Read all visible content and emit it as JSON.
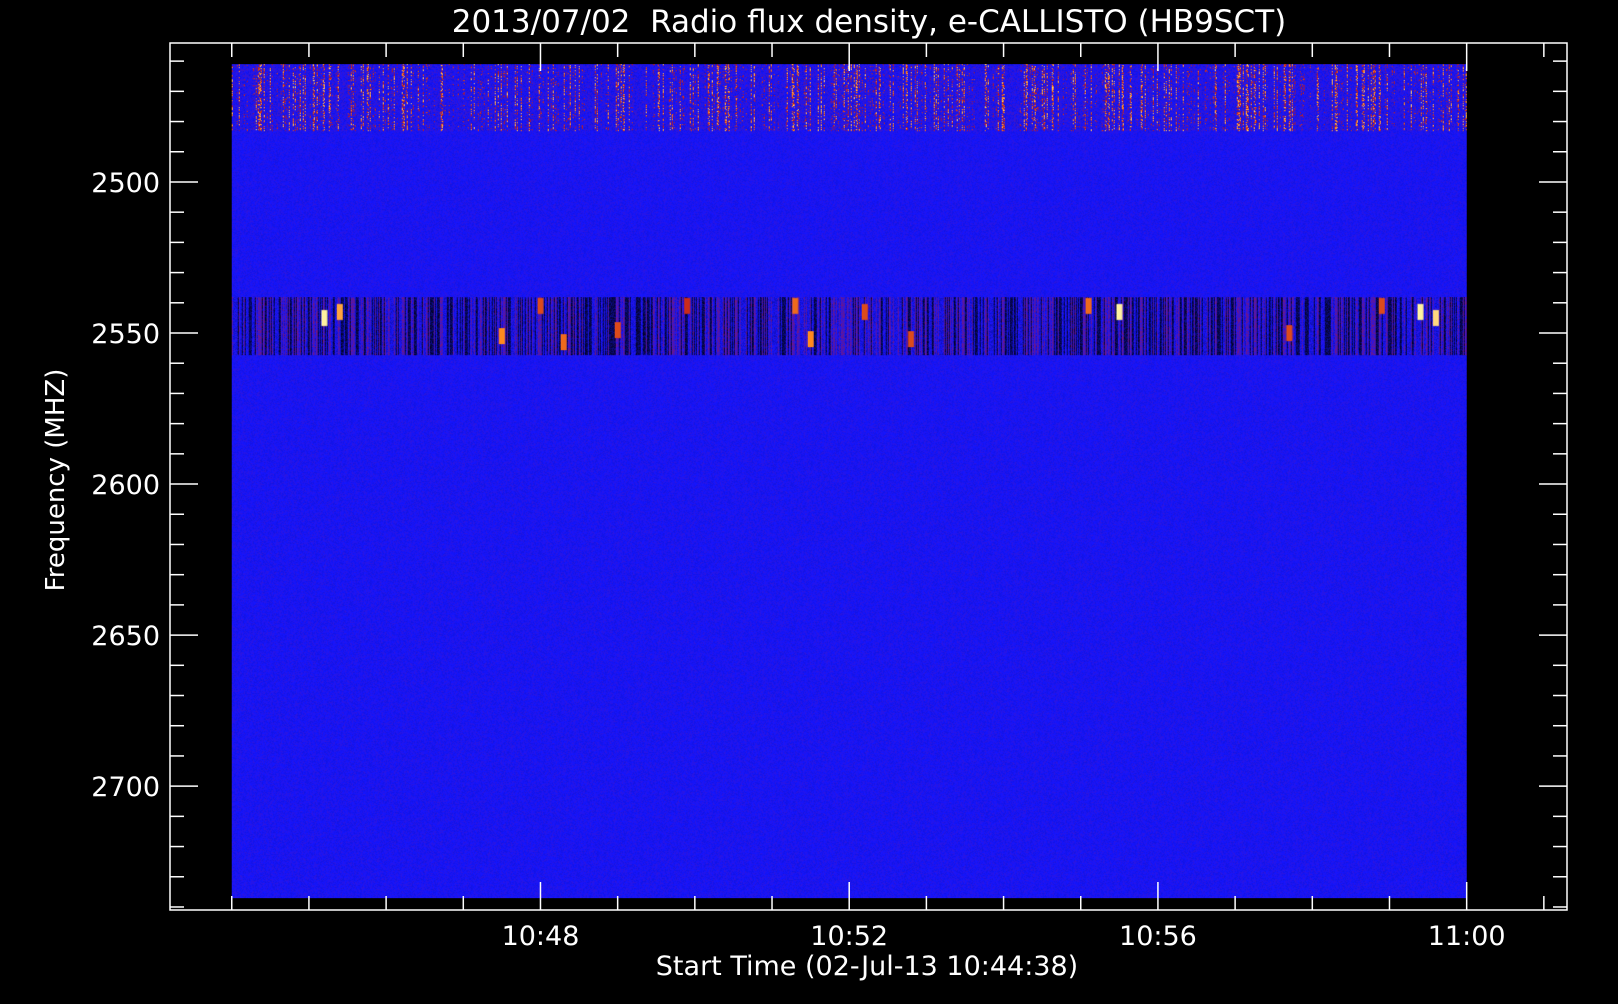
{
  "chart_data": {
    "type": "heatmap",
    "title": "2013/07/02  Radio flux density, e-CALLISTO (HB9SCT)",
    "xlabel": "Start Time (02-Jul-13 10:44:38)",
    "ylabel": "Frequency (MHZ)",
    "x_tick_labels": [
      "10:48",
      "10:52",
      "10:56",
      "11:00"
    ],
    "x_tick_minutes": [
      228,
      232,
      236,
      240
    ],
    "x_range_minutes": [
      223.2,
      241.3
    ],
    "data_range_minutes": [
      224.0,
      240.0
    ],
    "y_ticks": [
      2500,
      2550,
      2600,
      2650,
      2700
    ],
    "y_range": [
      2454,
      2741
    ],
    "data_freq_range": [
      2461,
      2737
    ],
    "y_inverted": true,
    "colormap": [
      "#000000",
      "#1515ff",
      "#c01818",
      "#ff8a1e",
      "#fff2a0"
    ],
    "background_level": 0.35,
    "bands": [
      {
        "from": 2461,
        "to": 2483,
        "description": "interference",
        "level": 0.75
      },
      {
        "from": 2538,
        "to": 2557,
        "description": "interference",
        "level": 0.6
      }
    ],
    "hot_spots": [
      {
        "minute": 225.2,
        "freq": 2545,
        "level": 1.0
      },
      {
        "minute": 225.4,
        "freq": 2543,
        "level": 0.85
      },
      {
        "minute": 227.5,
        "freq": 2551,
        "level": 0.8
      },
      {
        "minute": 228.0,
        "freq": 2541,
        "level": 0.7
      },
      {
        "minute": 228.3,
        "freq": 2553,
        "level": 0.75
      },
      {
        "minute": 229.0,
        "freq": 2549,
        "level": 0.7
      },
      {
        "minute": 229.9,
        "freq": 2541,
        "level": 0.65
      },
      {
        "minute": 231.3,
        "freq": 2541,
        "level": 0.75
      },
      {
        "minute": 231.5,
        "freq": 2552,
        "level": 0.8
      },
      {
        "minute": 232.2,
        "freq": 2543,
        "level": 0.7
      },
      {
        "minute": 232.8,
        "freq": 2552,
        "level": 0.7
      },
      {
        "minute": 235.1,
        "freq": 2541,
        "level": 0.75
      },
      {
        "minute": 235.5,
        "freq": 2543,
        "level": 1.0
      },
      {
        "minute": 237.7,
        "freq": 2550,
        "level": 0.7
      },
      {
        "minute": 238.9,
        "freq": 2541,
        "level": 0.7
      },
      {
        "minute": 239.4,
        "freq": 2543,
        "level": 1.0
      },
      {
        "minute": 239.6,
        "freq": 2545,
        "level": 0.95
      }
    ],
    "grid": false,
    "legend": "none"
  }
}
